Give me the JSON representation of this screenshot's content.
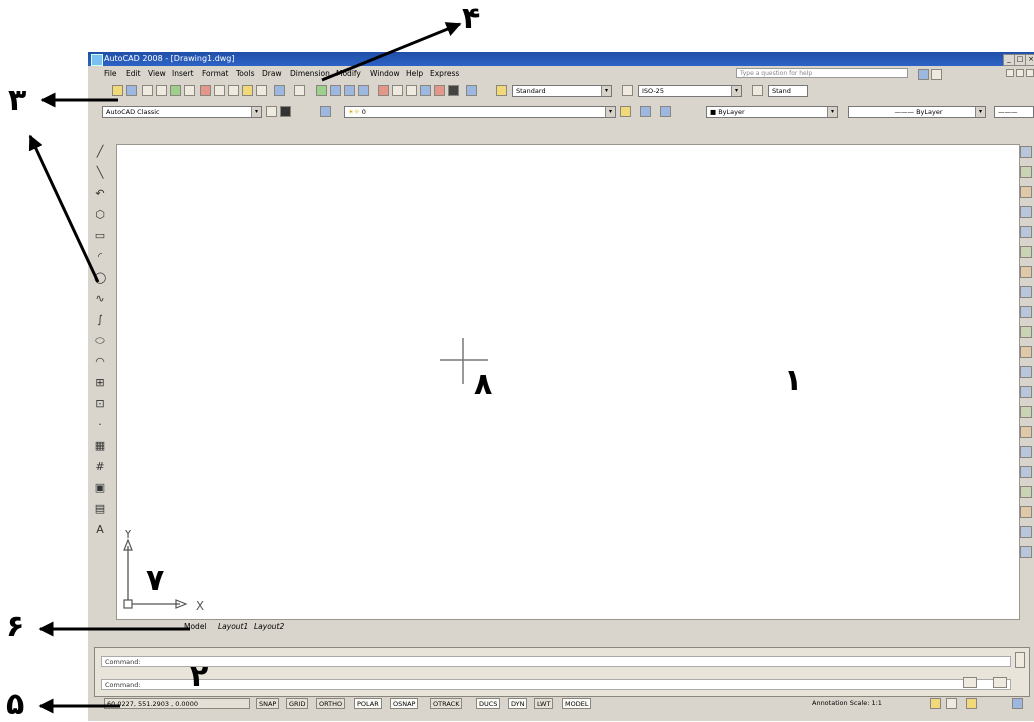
{
  "window": {
    "title": "AutoCAD 2008 - [Drawing1.dwg]",
    "controls": [
      "_",
      "□",
      "×"
    ]
  },
  "menu": {
    "items": [
      "File",
      "Edit",
      "View",
      "Insert",
      "Format",
      "Tools",
      "Draw",
      "Dimension",
      "Modify",
      "Window",
      "Help",
      "Express"
    ],
    "help_placeholder": "Type a question for help"
  },
  "toolbar": {
    "text_style": "Standard",
    "dim_style": "ISO-25",
    "table_style": "Stand",
    "workspace": "AutoCAD Classic",
    "layer": "0",
    "color": "ByLayer",
    "linetype": "ByLayer"
  },
  "layout_tabs": [
    "Model",
    "Layout1",
    "Layout2"
  ],
  "command": {
    "line1": "Command:",
    "line2": "Command:"
  },
  "status": {
    "coords": "60.0227, 551.2903 , 0.0000",
    "toggles": [
      "SNAP",
      "GRID",
      "ORTHO",
      "POLAR",
      "OSNAP",
      "OTRACK",
      "DUCS",
      "DYN",
      "LWT",
      "MODEL"
    ],
    "annotation_scale": "Annotation Scale: 1:1"
  },
  "ucs": {
    "x_label": "X",
    "y_label": "Y"
  },
  "annotations": {
    "n1": "۱",
    "n2": "۲",
    "n3": "۳",
    "n4": "۴",
    "n5": "۵",
    "n6": "۶",
    "n7": "۷",
    "n8": "۸"
  },
  "left_tools": [
    "line-icon",
    "construction-line-icon",
    "polyline-icon",
    "polygon-icon",
    "rectangle-icon",
    "arc-icon",
    "circle-icon",
    "revision-cloud-icon",
    "spline-icon",
    "ellipse-icon",
    "ellipse-arc-icon",
    "insert-block-icon",
    "make-block-icon",
    "point-icon",
    "hatch-icon",
    "gradient-icon",
    "region-icon",
    "table-icon",
    "multiline-text-icon"
  ],
  "left_tool_glyphs": [
    "╱",
    "╲",
    "↶",
    "⬡",
    "▭",
    "◜",
    "◯",
    "∿",
    "∫",
    "⬭",
    "◠",
    "⊞",
    "⊡",
    "·",
    "▦",
    "#",
    "▣",
    "▤",
    "A"
  ],
  "right_tools": [
    "erase-icon",
    "copy-icon",
    "mirror-icon",
    "offset-icon",
    "array-icon",
    "move-icon",
    "rotate-icon",
    "scale-icon",
    "stretch-icon",
    "trim-icon",
    "extend-icon",
    "break-at-point-icon",
    "break-icon",
    "join-icon",
    "chamfer-icon",
    "fillet-icon",
    "explode-icon",
    "properties-icon",
    "design-center-icon",
    "tool-palettes-icon",
    "sheet-set-icon"
  ]
}
